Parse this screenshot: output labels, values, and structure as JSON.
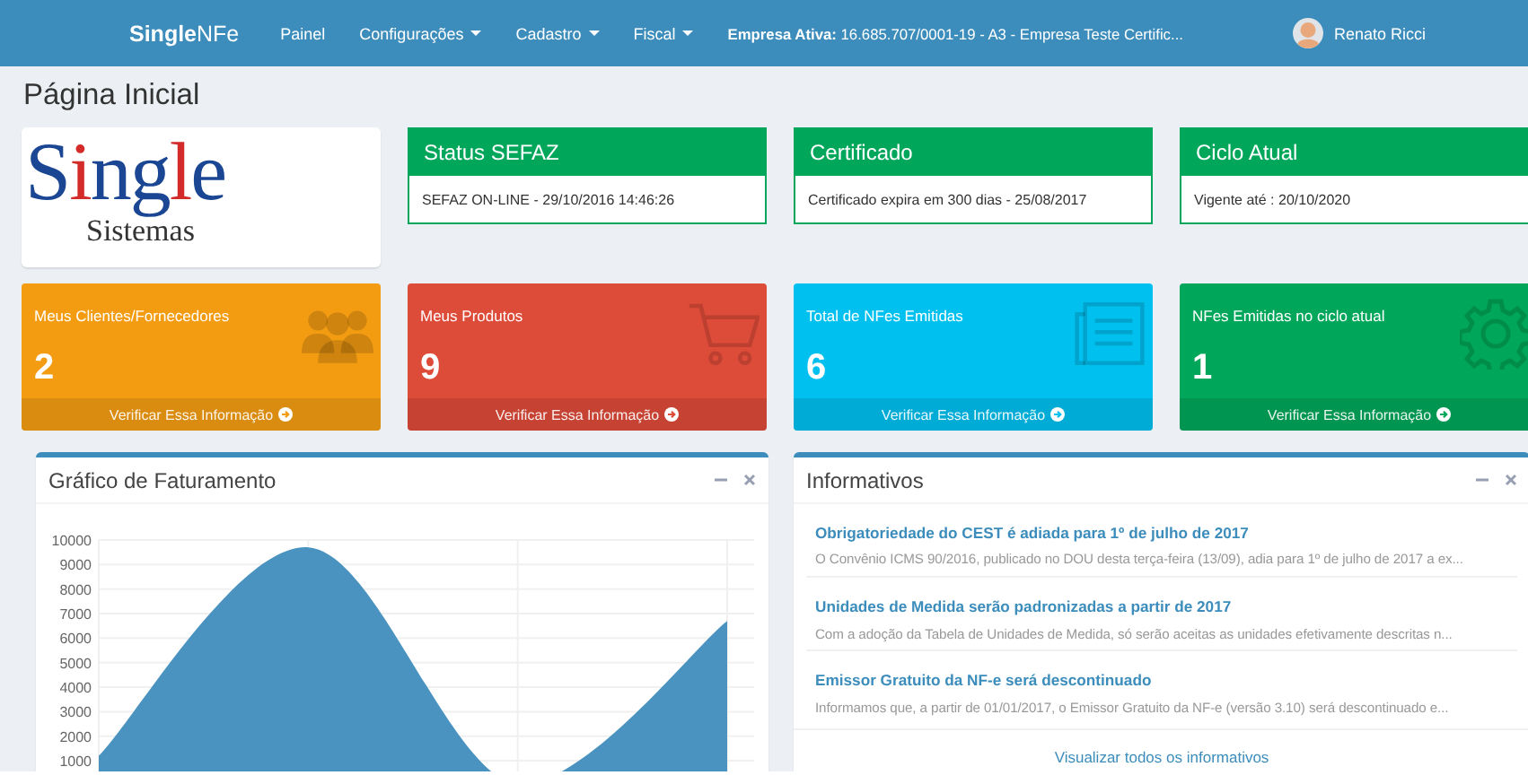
{
  "navbar": {
    "brand": "**Single**NFe",
    "menu": [
      {
        "label": "Painel",
        "dropdown": false
      },
      {
        "label": "Configurações",
        "dropdown": true
      },
      {
        "label": "Cadastro",
        "dropdown": true
      },
      {
        "label": "Fiscal",
        "dropdown": true
      }
    ],
    "active_company": "**Empresa Ativa:** 16.685.707/0001-19 - A3 - Empresa Teste Certific...",
    "user": {
      "name": "Renato Ricci"
    }
  },
  "page_title": "Página Inicial",
  "logo": {
    "name": "Single",
    "tagline": "Sistemas"
  },
  "status_cards": [
    {
      "title": "Status SEFAZ",
      "text": "SEFAZ ON-LINE - 29/10/2016 14:46:26"
    },
    {
      "title": "Certificado",
      "text": "Certificado expira em 300 dias - 25/08/2017"
    },
    {
      "title": "Ciclo Atual",
      "text": "Vigente até : 20/10/2020"
    }
  ],
  "stat_boxes": [
    {
      "label": "Meus Clientes/Fornecedores",
      "value": "2",
      "link": "Verificar Essa Informação",
      "color": "#f39c12",
      "kind": "users"
    },
    {
      "label": "Meus Produtos",
      "value": "9",
      "link": "Verificar Essa Informação",
      "color": "#dd4b39",
      "kind": "cart"
    },
    {
      "label": "Total de NFes Emitidas",
      "value": "6",
      "link": "Verificar Essa Informação",
      "color": "#00c0ef",
      "kind": "document"
    },
    {
      "label": "NFes Emitidas no ciclo atual",
      "value": "1",
      "link": "Verificar Essa Informação",
      "color": "#00a65a",
      "kind": "gear"
    }
  ],
  "chart_panel": {
    "title": "Gráfico de Faturamento",
    "chart_data": {
      "type": "area",
      "grid": true,
      "values": [
        1200,
        9700,
        0,
        6700
      ],
      "ylim": [
        0,
        10000
      ],
      "yticks": [
        1000,
        2000,
        3000,
        4000,
        5000,
        6000,
        7000,
        8000,
        9000,
        10000
      ]
    }
  },
  "news_panel": {
    "title": "Informativos",
    "items": [
      {
        "title": "Obrigatoriedade do CEST é adiada para 1º de julho de 2017",
        "summary": "O Convênio ICMS 90/2016, publicado no DOU desta terça-feira (13/09), adia para 1º de julho de 2017 a ex..."
      },
      {
        "title": "Unidades de Medida serão padronizadas a partir de 2017",
        "summary": "Com a adoção da Tabela de Unidades de Medida, só serão aceitas as unidades efetivamente descritas n..."
      },
      {
        "title": "Emissor Gratuito da NF-e será descontinuado",
        "summary": "Informamos que, a partir de 01/01/2017, o Emissor Gratuito da NF-e (versão 3.10) será descontinuado e..."
      }
    ],
    "footer_link": "Visualizar todos os informativos"
  }
}
